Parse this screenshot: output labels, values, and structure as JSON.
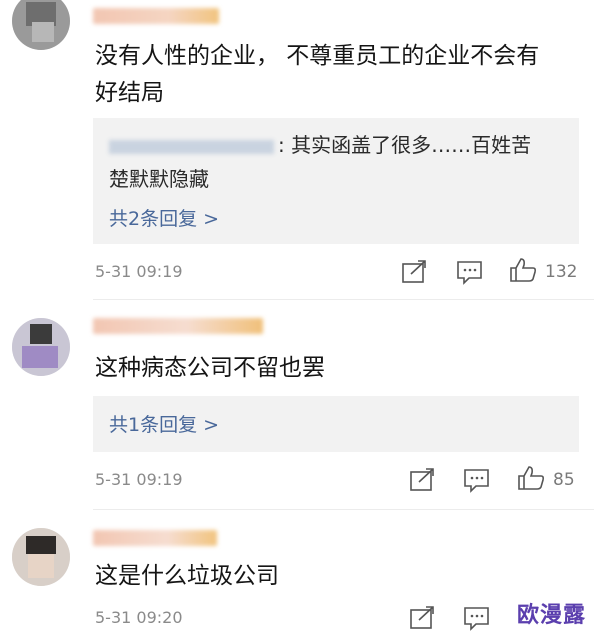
{
  "comments": [
    {
      "text_line1": "没有人性的企业， 不尊重员工的企业不会有",
      "text_line2": "好结局",
      "reply_text_line1": ": 其实函盖了很多……百姓苦",
      "reply_text_line2": "楚默默隐藏",
      "more_replies": "共2条回复 >",
      "time": "5-31 09:19",
      "likes": "132"
    },
    {
      "text": "这种病态公司不留也罢",
      "more_replies": "共1条回复 >",
      "time": "5-31 09:19",
      "likes": "85"
    },
    {
      "text": "这是什么垃圾公司",
      "time": "5-31 09:20"
    }
  ],
  "watermark": "欧漫露",
  "icons": [
    "share-icon",
    "comment-icon",
    "like-icon"
  ],
  "colors": {
    "link": "#49689a",
    "time": "#8a8a8a",
    "reply_bg": "#f2f2f2",
    "watermark": "#5b3fae"
  }
}
